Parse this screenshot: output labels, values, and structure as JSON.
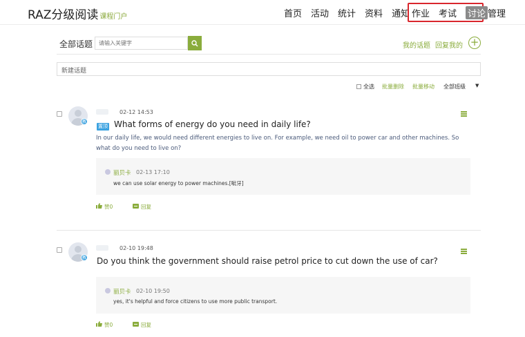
{
  "header": {
    "brand": "RAZ分级阅读",
    "brand_sub": "课程门户",
    "nav": [
      "首页",
      "活动",
      "统计",
      "资料",
      "通知"
    ],
    "nav_highlighted": [
      "作业",
      "考试"
    ],
    "nav_active": "讨论",
    "nav_manage": "管理"
  },
  "topics": {
    "title": "全部话题",
    "search_placeholder": "请输入关键字",
    "my_topics": "我的话题",
    "my_replies": "回复我的",
    "new_topic": "新建话题"
  },
  "toolbar": {
    "select_all": "全选",
    "bulk_delete": "批量删除",
    "bulk_move": "批量移动",
    "class_select": "全部班级"
  },
  "posts": [
    {
      "time": "02-12 14:53",
      "badge": "教",
      "tag": "置顶",
      "title": "What forms of energy do you need in daily life?",
      "body": "In our daily life, we would need different energies to live on. For example, we need oil to power car and other machines. So what do you need to live on?",
      "reply": {
        "author": "丽贝卡",
        "time": "02-13 17:10",
        "text": "we can use solar energy to power machines.[呲牙]"
      },
      "likes": "赞0",
      "reply_label": "回复"
    },
    {
      "time": "02-10 19:48",
      "badge": "教",
      "title": "Do you think the government should raise petrol price to cut down the use of car?",
      "reply": {
        "author": "丽贝卡",
        "time": "02-10 19:50",
        "text": "yes, it's helpful and force citizens to use more public transport."
      },
      "likes": "赞0",
      "reply_label": "回复"
    }
  ],
  "colors": {
    "accent": "#8aac3c",
    "highlight_box": "#d9262c",
    "badge_blue": "#3ba2e0"
  }
}
